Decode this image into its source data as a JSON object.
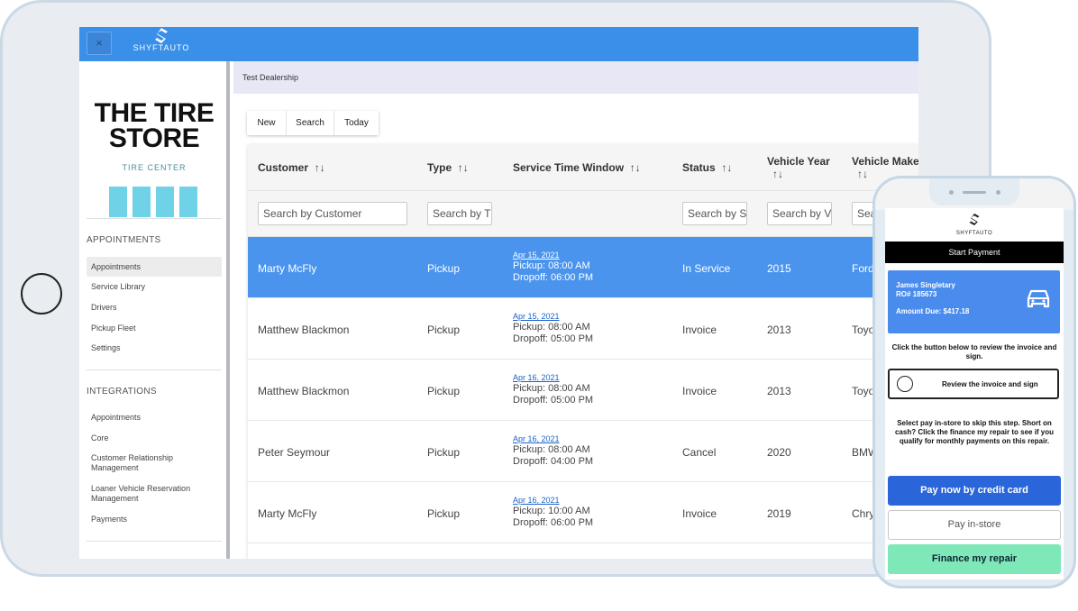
{
  "top_bar": {
    "close_icon_label": "×",
    "logo_text": "SHYFTAUTO",
    "color": "#3a8fe8"
  },
  "sidebar": {
    "brand_line1": "THE TIRE",
    "brand_line2": "STORE",
    "brand_sub": "TIRE CENTER",
    "sections": [
      {
        "heading": "APPOINTMENTS",
        "items": [
          "Appointments",
          "Service Library",
          "Drivers",
          "Pickup Fleet",
          "Settings"
        ]
      },
      {
        "heading": "INTEGRATIONS",
        "items": [
          "Appointments",
          "Core",
          "Customer Relationship Management",
          "Loaner Vehicle Reservation Management",
          "Payments"
        ]
      }
    ],
    "active_item": "Appointments"
  },
  "breadcrumb": "Test Dealership",
  "toolbar": {
    "new_label": "New",
    "search_label": "Search",
    "today_label": "Today"
  },
  "table": {
    "headers": [
      "Customer",
      "Type",
      "Service Time Window",
      "Status",
      "Vehicle Year",
      "Vehicle Make"
    ],
    "sort_glyph": "↑↓",
    "filters": {
      "customer": "Search by Customer",
      "type": "Search by T",
      "status": "Search by S",
      "year": "Search by V",
      "make": "Sea"
    },
    "rows": [
      {
        "customer": "Marty McFly",
        "type": "Pickup",
        "date": "Apr 15, 2021",
        "pickup": "Pickup: 08:00 AM",
        "dropoff": "Dropoff: 06:00 PM",
        "status": "In Service",
        "year": "2015",
        "make": "Ford",
        "selected": true
      },
      {
        "customer": "Matthew Blackmon",
        "type": "Pickup",
        "date": "Apr 15, 2021",
        "pickup": "Pickup: 08:00 AM",
        "dropoff": "Dropoff: 05:00 PM",
        "status": "Invoice",
        "year": "2013",
        "make": "Toyo",
        "selected": false
      },
      {
        "customer": "Matthew Blackmon",
        "type": "Pickup",
        "date": "Apr 16, 2021",
        "pickup": "Pickup: 08:00 AM",
        "dropoff": "Dropoff: 05:00 PM",
        "status": "Invoice",
        "year": "2013",
        "make": "Toyo",
        "selected": false
      },
      {
        "customer": "Peter Seymour",
        "type": "Pickup",
        "date": "Apr 16, 2021",
        "pickup": "Pickup: 08:00 AM",
        "dropoff": "Dropoff: 04:00 PM",
        "status": "Cancel",
        "year": "2020",
        "make": "BMW",
        "selected": false
      },
      {
        "customer": "Marty McFly",
        "type": "Pickup",
        "date": "Apr 16, 2021",
        "pickup": "Pickup: 10:00 AM",
        "dropoff": "Dropoff: 06:00 PM",
        "status": "Invoice",
        "year": "2019",
        "make": "Chrys",
        "selected": false
      }
    ]
  },
  "phone": {
    "logo_text": "SHYFTAUTO",
    "start_payment": "Start Payment",
    "customer_name": "James Singletary",
    "ro_number": "RO# 185673",
    "amount_due": "Amount Due: $417.18",
    "review_note": "Click the button below to review the invoice and sign.",
    "review_button": "Review the invoice and sign",
    "skip_note": "Select pay in-store to skip this step. Short on cash? Click the finance my repair to see if you qualify for monthly payments on this repair.",
    "credit_button": "Pay now by credit card",
    "instore_button": "Pay in-store",
    "finance_button": "Finance my repair"
  }
}
